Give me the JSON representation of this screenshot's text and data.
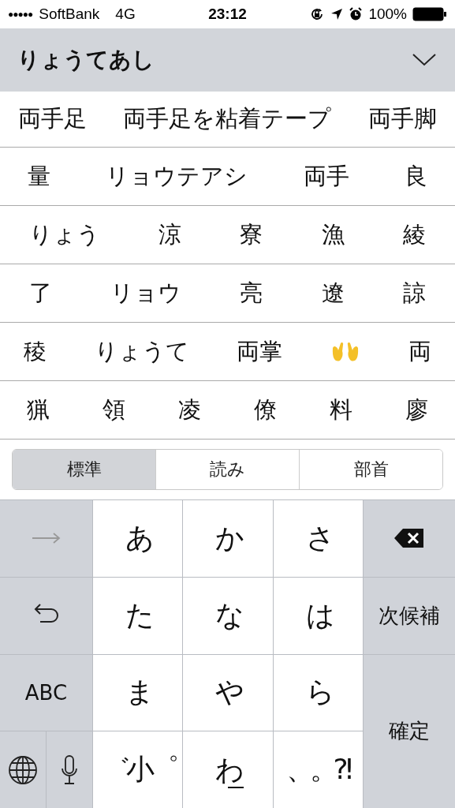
{
  "status_bar": {
    "signal_dots": "●●●●●",
    "carrier": "SoftBank",
    "network": "4G",
    "time": "23:12",
    "battery": "100%"
  },
  "header": {
    "reading": "りょうてあし"
  },
  "candidate_rows": [
    [
      {
        "kind": "text",
        "text": "両手足"
      },
      {
        "kind": "text",
        "text": "両手足を粘着テープ"
      },
      {
        "kind": "text",
        "text": "両手脚"
      }
    ],
    [
      {
        "kind": "text",
        "text": "量"
      },
      {
        "kind": "text",
        "text": "リョウテアシ"
      },
      {
        "kind": "text",
        "text": "両手"
      },
      {
        "kind": "text",
        "text": "良"
      }
    ],
    [
      {
        "kind": "text",
        "text": "りょう"
      },
      {
        "kind": "text",
        "text": "涼"
      },
      {
        "kind": "text",
        "text": "寮"
      },
      {
        "kind": "text",
        "text": "漁"
      },
      {
        "kind": "text",
        "text": "綾"
      }
    ],
    [
      {
        "kind": "text",
        "text": "了"
      },
      {
        "kind": "text",
        "text": "リョウ"
      },
      {
        "kind": "text",
        "text": "亮"
      },
      {
        "kind": "text",
        "text": "遼"
      },
      {
        "kind": "text",
        "text": "諒"
      }
    ],
    [
      {
        "kind": "text",
        "text": "稜"
      },
      {
        "kind": "text",
        "text": "りょうて"
      },
      {
        "kind": "text",
        "text": "両掌"
      },
      {
        "kind": "emoji"
      },
      {
        "kind": "text",
        "text": "両"
      }
    ],
    [
      {
        "kind": "text",
        "text": "猟"
      },
      {
        "kind": "text",
        "text": "領"
      },
      {
        "kind": "text",
        "text": "凌"
      },
      {
        "kind": "text",
        "text": "僚"
      },
      {
        "kind": "text",
        "text": "料"
      },
      {
        "kind": "text",
        "text": "廖"
      }
    ]
  ],
  "segments": [
    {
      "label": "標準",
      "selected": true
    },
    {
      "label": "読み",
      "selected": false
    },
    {
      "label": "部首",
      "selected": false
    }
  ],
  "keys": [
    {
      "kind": "arrow"
    },
    {
      "kind": "char",
      "label": "あ"
    },
    {
      "kind": "char",
      "label": "か"
    },
    {
      "kind": "char",
      "label": "さ"
    },
    {
      "kind": "backspace"
    },
    {
      "kind": "undo"
    },
    {
      "kind": "char",
      "label": "た"
    },
    {
      "kind": "char",
      "label": "な"
    },
    {
      "kind": "char",
      "label": "は"
    },
    {
      "kind": "func",
      "label": "次候補"
    },
    {
      "kind": "func",
      "label": "ABC"
    },
    {
      "kind": "char",
      "label": "ま"
    },
    {
      "kind": "char",
      "label": "や"
    },
    {
      "kind": "char",
      "label": "ら"
    },
    {
      "kind": "func",
      "label": "確定"
    },
    {
      "kind": "globe"
    },
    {
      "kind": "mic"
    },
    {
      "kind": "char",
      "label": "゛小゜"
    },
    {
      "kind": "space",
      "label": "わ"
    },
    {
      "kind": "char",
      "label": "、。?!"
    }
  ]
}
